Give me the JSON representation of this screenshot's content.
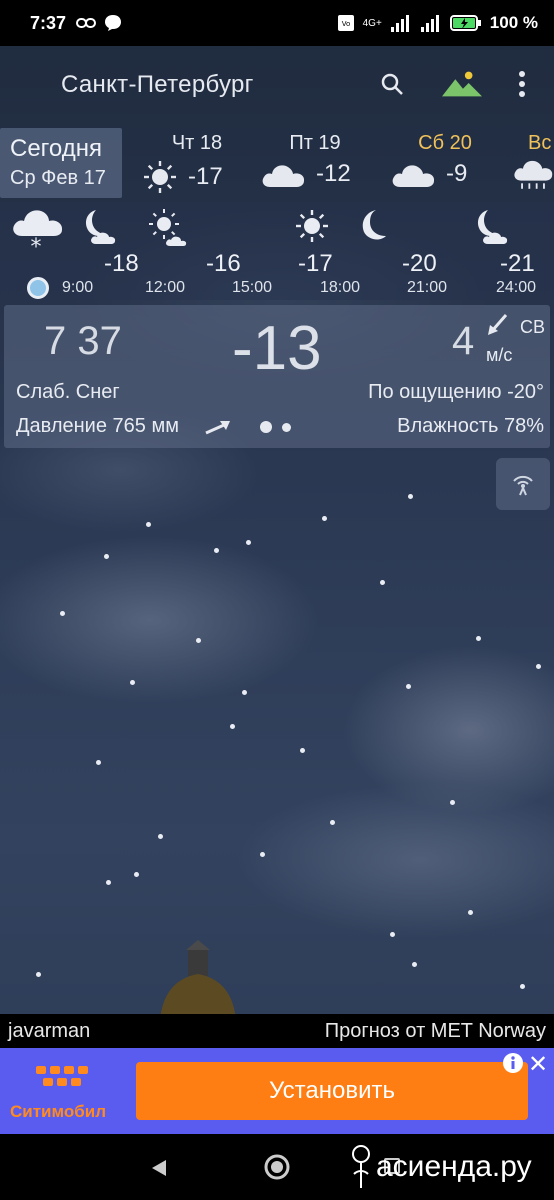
{
  "status_bar": {
    "time": "7:37",
    "battery": "100 %",
    "network": "4G+"
  },
  "header": {
    "city": "Санкт-Петербург"
  },
  "days": {
    "today": {
      "label": "Сегодня",
      "date": "Ср Фев 17"
    },
    "forecast": [
      {
        "name": "Чт 18",
        "temp": "-17",
        "icon": "sun-icon"
      },
      {
        "name": "Пт 19",
        "temp": "-12",
        "icon": "cloud-icon"
      },
      {
        "name": "Сб 20",
        "temp": "-9",
        "icon": "cloud-icon"
      },
      {
        "name": "Вс",
        "temp": "",
        "icon": "snow-cloud-icon"
      }
    ]
  },
  "hourly": {
    "temps": [
      "-18",
      "-16",
      "-17",
      "-20",
      "-21"
    ],
    "times": [
      "9:00",
      "12:00",
      "15:00",
      "18:00",
      "21:00",
      "24:00"
    ]
  },
  "current": {
    "time": "7 37",
    "temp": "-13",
    "wind_speed": "4",
    "wind_dir": "СВ",
    "wind_unit": "м/с",
    "condition": "Слаб. Снег",
    "feels_like": "По ощущению -20°",
    "pressure": "Давление 765 мм",
    "humidity": "Влажность 78%"
  },
  "credit": {
    "user": "javarman",
    "source": "Прогноз от MET Norway"
  },
  "ad": {
    "brand": "Ситимобил",
    "install": "Установить"
  },
  "watermark": "асиенда.ру",
  "colors": {
    "accent_day": "#f0c15a",
    "ad_bg": "#5a5cf0",
    "ad_button": "#ff7e14"
  }
}
